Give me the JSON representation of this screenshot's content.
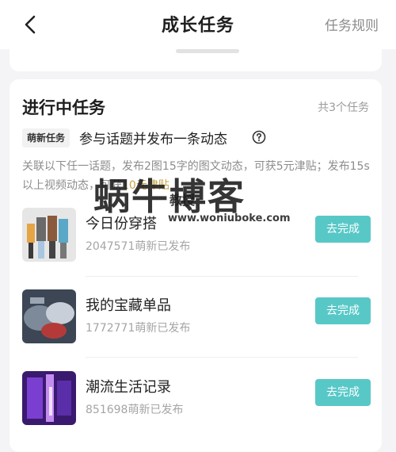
{
  "nav": {
    "title": "成长任务",
    "rules": "任务规则"
  },
  "card": {
    "title": "进行中任务",
    "count": "共3个任务",
    "task": {
      "tag": "萌新任务",
      "name": "参与话题并发布一条动态",
      "desc_prefix": "关联以下任一话题，发布2图15字的图文动态，可获5元津贴；发布15s以上视频动态，可获",
      "desc_highlight": "10元津贴"
    },
    "items": [
      {
        "title": "今日份穿搭",
        "meta": "2047571萌新已发布",
        "button": "去完成"
      },
      {
        "title": "我的宝藏单品",
        "meta": "1772771萌新已发布",
        "button": "去完成"
      },
      {
        "title": "潮流生活记录",
        "meta": "851698萌新已发布",
        "button": "去完成"
      }
    ]
  },
  "watermark": {
    "main": "蜗牛博客",
    "sub": "教授",
    "url": "www.woniubo​ke.com"
  },
  "colors": {
    "accent": "#58c8c7",
    "highlight": "#c9a24a",
    "background": "#f4f4f6"
  }
}
